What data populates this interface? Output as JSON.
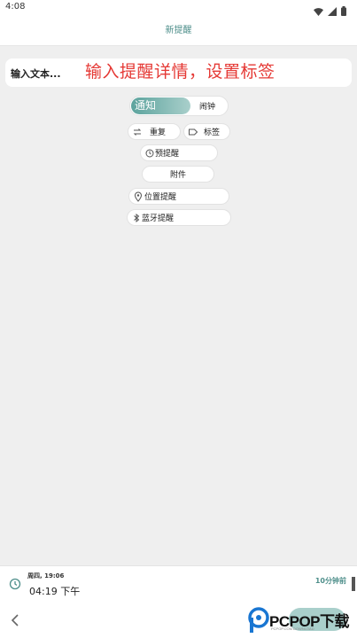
{
  "status_bar": {
    "time": "4:08",
    "icons": [
      "wifi-icon",
      "signal-icon",
      "battery-icon"
    ]
  },
  "app_bar": {
    "title": "新提醒"
  },
  "reminder_input": {
    "value": "输入文本..."
  },
  "annotation": {
    "text": "输入提醒详情，设置标签",
    "color": "#e53935"
  },
  "type_toggle": {
    "options": [
      "通知",
      "闹钟"
    ],
    "selected": "通知"
  },
  "options": {
    "repeat": {
      "label": "重复",
      "icon": "repeat-icon"
    },
    "tag": {
      "label": "标签",
      "icon": "tag-icon"
    },
    "pre_reminder": {
      "label": "预提醒",
      "icon": "history-icon"
    },
    "attachment": {
      "label": "附件"
    },
    "location": {
      "label": "位置提醒",
      "icon": "location-pin-icon"
    },
    "bluetooth": {
      "label": "蓝牙提醒",
      "icon": "bluetooth-icon"
    }
  },
  "schedule": {
    "date": "周四, 19:06",
    "time": "04:19 下午",
    "offset": "10分钟前",
    "icon": "clock-icon"
  },
  "nav": {
    "back_icon": "chevron-left-icon"
  },
  "watermark": {
    "text": "PCPOP下载",
    "sub": "PCPOP.COM DOWNLOAD"
  },
  "colors": {
    "accent": "#4f8f8b",
    "accent_light": "#a9cfcb",
    "background": "#efefef"
  }
}
